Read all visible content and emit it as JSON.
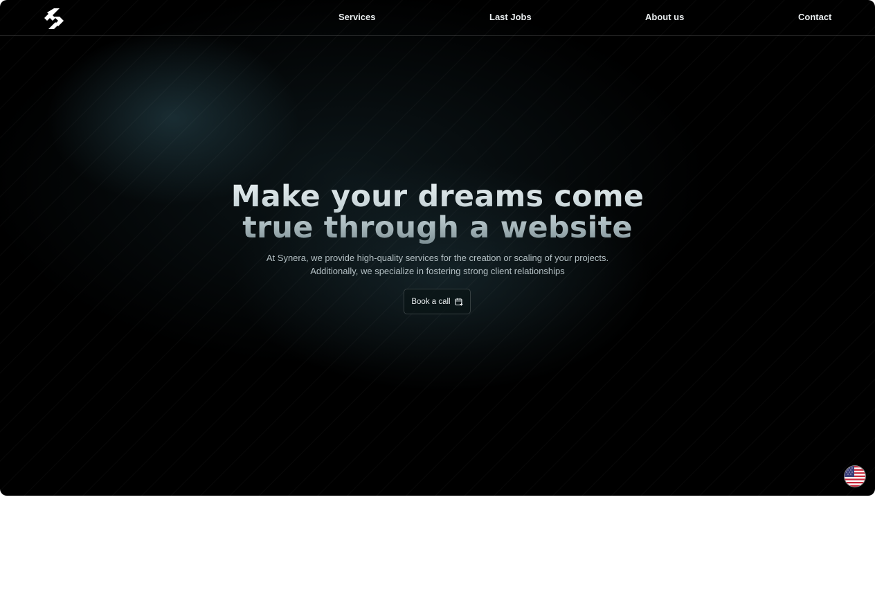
{
  "brand": {
    "logo_icon": "synera-s-logo-icon"
  },
  "nav": {
    "items": [
      {
        "label": "Services"
      },
      {
        "label": "Last Jobs"
      },
      {
        "label": "About us"
      },
      {
        "label": "Contact"
      }
    ]
  },
  "hero": {
    "headline_line1": "Make your dreams come",
    "headline_line2": "true through a website",
    "subtitle_line1": "At Synera, we provide high-quality services for the creation or scaling of your projects.",
    "subtitle_line2": "Additionally, we specialize in fostering strong client relationships",
    "cta_label": "Book a call",
    "cta_icon": "calendar-plus-icon"
  },
  "language_switcher": {
    "icon": "us-flag-icon"
  },
  "colors": {
    "background": "#000000",
    "page": "#ffffff",
    "nav_text": "#e8ecee",
    "subtitle_text": "#b4c0c4",
    "glow": "#223a42"
  }
}
